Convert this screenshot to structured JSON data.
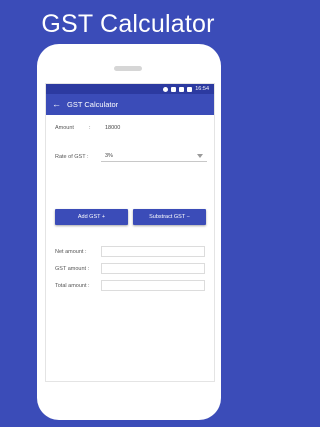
{
  "banner": {
    "title": "GST Calculator"
  },
  "statusbar": {
    "time": "16:54"
  },
  "appbar": {
    "title": "GST Calculator"
  },
  "form": {
    "amount_label": "Amount",
    "amount_colon": ":",
    "amount_value": "18000",
    "rate_label": "Rate of GST :",
    "rate_value": "3%"
  },
  "buttons": {
    "add_label": "Add GST +",
    "subtract_label": "Substract GST −"
  },
  "results": [
    {
      "label": "Net amount  :",
      "value": ""
    },
    {
      "label": "GST amount :",
      "value": ""
    },
    {
      "label": "Total amount :",
      "value": ""
    }
  ],
  "colors": {
    "primary": "#3b4cb8",
    "statusbar": "#2c3aa0"
  }
}
